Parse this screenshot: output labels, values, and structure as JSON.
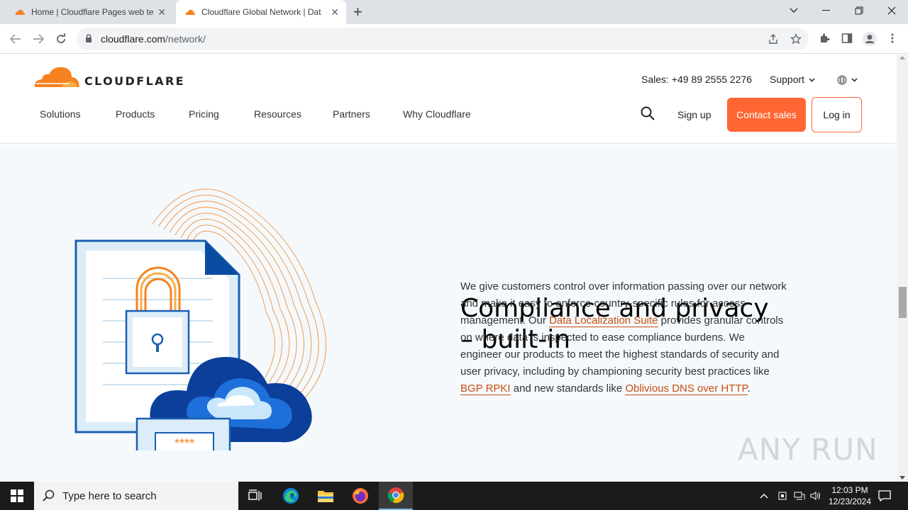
{
  "browser": {
    "tabs": [
      {
        "title": "Home | Cloudflare Pages web te",
        "active": false
      },
      {
        "title": "Cloudflare Global Network | Dat",
        "active": true
      }
    ],
    "url_domain": "cloudflare.com",
    "url_path": "/network/"
  },
  "header": {
    "logo_text": "CLOUDFLARE",
    "sales": "Sales: +49 89 2555 2276",
    "support": "Support",
    "menu": [
      "Solutions",
      "Products",
      "Pricing",
      "Resources",
      "Partners",
      "Why Cloudflare"
    ],
    "sign_up": "Sign up",
    "contact_sales": "Contact sales",
    "log_in": "Log in"
  },
  "section": {
    "heading_line1": "Compliance and privacy",
    "heading_line2": "– built-in",
    "body_p1": "We give customers control over information passing over our network and make it easy to enforce country-specific rules for access management. Our ",
    "link1": "Data Localization Suite",
    "body_p2": " provides granular controls on where data is inspected to ease compliance burdens. We engineer our products to meet the highest standards of security and user privacy, including by championing security best practices like ",
    "link2": "BGP RPKI",
    "body_p3": " and new standards like ",
    "link3": "Oblivious DNS over HTTP",
    "body_p4": ".",
    "password_mask": "****"
  },
  "watermark": "ANY RUN",
  "taskbar": {
    "search_placeholder": "Type here to search",
    "time": "12:03 PM",
    "date": "12/23/2024"
  },
  "colors": {
    "brand_orange": "#f6821f",
    "contact_button": "#ff6633",
    "link": "#c74d0f",
    "section_bg": "#f5f9fc"
  }
}
